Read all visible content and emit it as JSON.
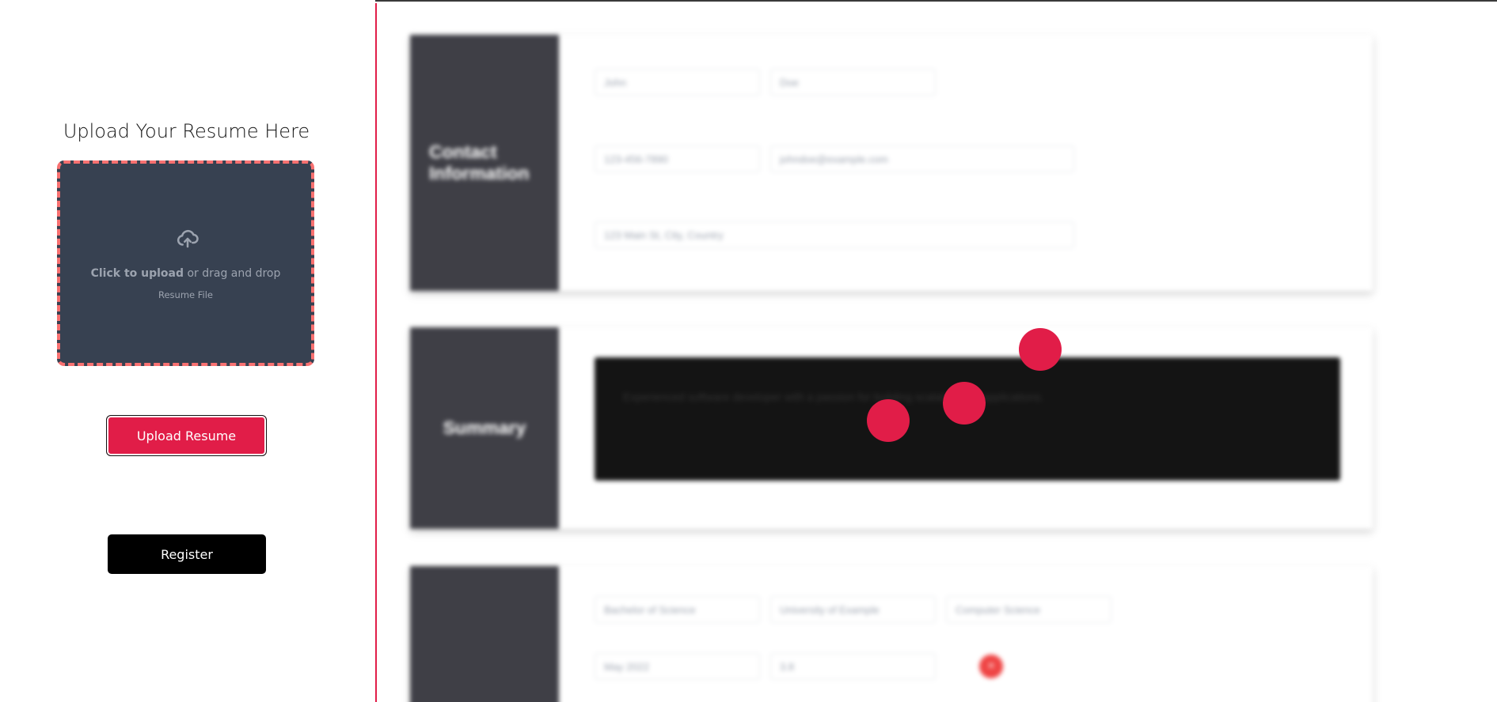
{
  "upload_panel": {
    "title": "Upload Your Resume Here",
    "dropzone": {
      "icon": "cloud-upload-icon",
      "click_text": "Click to upload",
      "drag_text": " or drag and drop",
      "file_hint": "Resume File"
    },
    "upload_button": "Upload Resume",
    "register_button": "Register"
  },
  "resume_preview": {
    "contact": {
      "heading": "Contact Information",
      "first_name": "John",
      "last_name": "Doe",
      "phone": "123-456-7890",
      "email": "johndoe@example.com",
      "address": "123 Main St, City, Country"
    },
    "summary": {
      "heading": "Summary",
      "text": "Experienced software developer with a passion for building scalable web applications."
    },
    "education": {
      "heading": "",
      "degree": "Bachelor of Science",
      "institution": "University of Example",
      "field": "Computer Science",
      "graduation": "May 2022",
      "gpa": "3.8",
      "remove_label": "×"
    }
  },
  "colors": {
    "accent": "#e11d48",
    "dropzone_bg": "#374151",
    "dropzone_border": "#f87171",
    "section_header": "#3f3f46"
  }
}
